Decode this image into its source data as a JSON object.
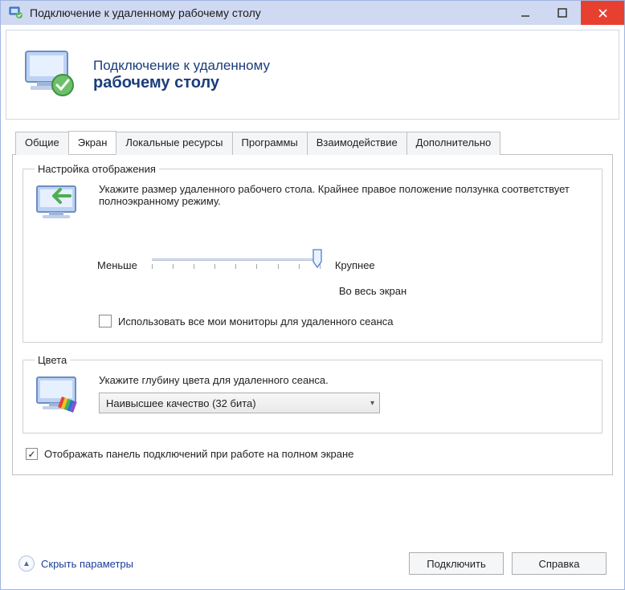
{
  "window": {
    "title": "Подключение к удаленному рабочему столу"
  },
  "header": {
    "line1": "Подключение к удаленному",
    "line2": "рабочему столу"
  },
  "tabs": {
    "general": "Общие",
    "screen": "Экран",
    "local": "Локальные ресурсы",
    "programs": "Программы",
    "experience": "Взаимодействие",
    "advanced": "Дополнительно"
  },
  "display_group": {
    "legend": "Настройка отображения",
    "desc": "Укажите размер удаленного рабочего стола. Крайнее правое положение ползунка соответствует полноэкранному режиму.",
    "less": "Меньше",
    "more": "Крупнее",
    "fullscreen": "Во весь экран",
    "use_all_monitors": "Использовать все мои мониторы для удаленного сеанса",
    "use_all_monitors_checked": false
  },
  "colors_group": {
    "legend": "Цвета",
    "desc": "Укажите глубину цвета для удаленного сеанса.",
    "selected": "Наивысшее качество (32 бита)"
  },
  "pin_bar": {
    "label": "Отображать панель подключений при работе на полном экране",
    "checked": true
  },
  "footer": {
    "hide": "Скрыть параметры",
    "connect": "Подключить",
    "help": "Справка"
  }
}
